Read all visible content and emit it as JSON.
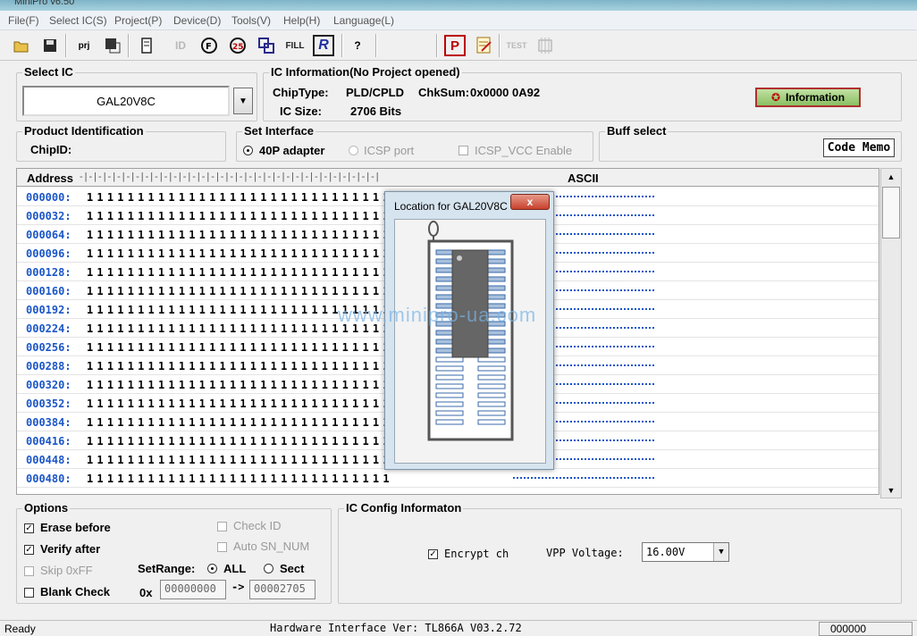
{
  "window": {
    "title": "MiniPro v6.50"
  },
  "menu": [
    "File(F)",
    "Select IC(S)",
    "Project(P)",
    "Device(D)",
    "Tools(V)",
    "Help(H)",
    "Language(L)"
  ],
  "toolbar": {
    "prj_label": "prj",
    "fill_label": "FILL",
    "r_label": "R",
    "p_label": "P",
    "test_label": "TEST",
    "help_label": "?"
  },
  "select_ic": {
    "title": "Select IC",
    "value": "GAL20V8C"
  },
  "ic_info": {
    "title": "IC Information(No Project opened)",
    "chiptype_label": "ChipType:",
    "chiptype_value": "PLD/CPLD",
    "chksum_label": "ChkSum:",
    "chksum_value": "0x0000 0A92",
    "icsize_label": "IC Size:",
    "icsize_value": "2706 Bits",
    "info_button": "Information"
  },
  "product_id": {
    "title": "Product Identification",
    "chipid_label": "ChipID:"
  },
  "interface": {
    "title": "Set Interface",
    "opt1": "40P adapter",
    "opt2": "ICSP port",
    "opt3": "ICSP_VCC Enable"
  },
  "buff": {
    "title": "Buff select",
    "button": "Code Memo"
  },
  "grid": {
    "address_header": "Address",
    "ascii_header": "ASCII",
    "rows": [
      {
        "addr": "000000:",
        "bits": "111111111111111111111111111111"
      },
      {
        "addr": "000032:",
        "bits": "111111111111111111111111111111"
      },
      {
        "addr": "000064:",
        "bits": "111111111111111111111111111111"
      },
      {
        "addr": "000096:",
        "bits": "111111111111111111111111111111"
      },
      {
        "addr": "000128:",
        "bits": "111111111111111111111111111111"
      },
      {
        "addr": "000160:",
        "bits": "111111111111111111111111111111"
      },
      {
        "addr": "000192:",
        "bits": "111111111111111111111111111111"
      },
      {
        "addr": "000224:",
        "bits": "111111111111111111111111111111"
      },
      {
        "addr": "000256:",
        "bits": "111111111111111111111111111111"
      },
      {
        "addr": "000288:",
        "bits": "111111111111111111111111111111"
      },
      {
        "addr": "000320:",
        "bits": "111111111111111111111111111111"
      },
      {
        "addr": "000352:",
        "bits": "111111111111111111111111111111"
      },
      {
        "addr": "000384:",
        "bits": "111111111111111111111111111111"
      },
      {
        "addr": "000416:",
        "bits": "111111111111111111111111111111"
      },
      {
        "addr": "000448:",
        "bits": "111111111111111111111111111111"
      },
      {
        "addr": "000480:",
        "bits": "111111111111111111111111111111"
      }
    ]
  },
  "popup": {
    "title": "Location for  GAL20V8C",
    "close": "x",
    "watermark": "www.minipro-ua.com"
  },
  "options": {
    "title": "Options",
    "erase": "Erase before",
    "verify": "Verify after",
    "skip": "Skip 0xFF",
    "blank": "Blank Check",
    "checkid": "Check ID",
    "autosn": "Auto SN_NUM",
    "setrange_label": "SetRange:",
    "all": "ALL",
    "sect": "Sect",
    "ox_label": "0x",
    "start": "00000000",
    "arrow": "->",
    "end": "00002705"
  },
  "ic_config": {
    "title": "IC Config Informaton",
    "encrypt": "Encrypt ch",
    "vpp_label": "VPP Voltage:",
    "vpp_value": "16.00V"
  },
  "status": {
    "left": "Ready",
    "center": "Hardware Interface Ver: TL866A V03.2.72",
    "right": "000000"
  }
}
